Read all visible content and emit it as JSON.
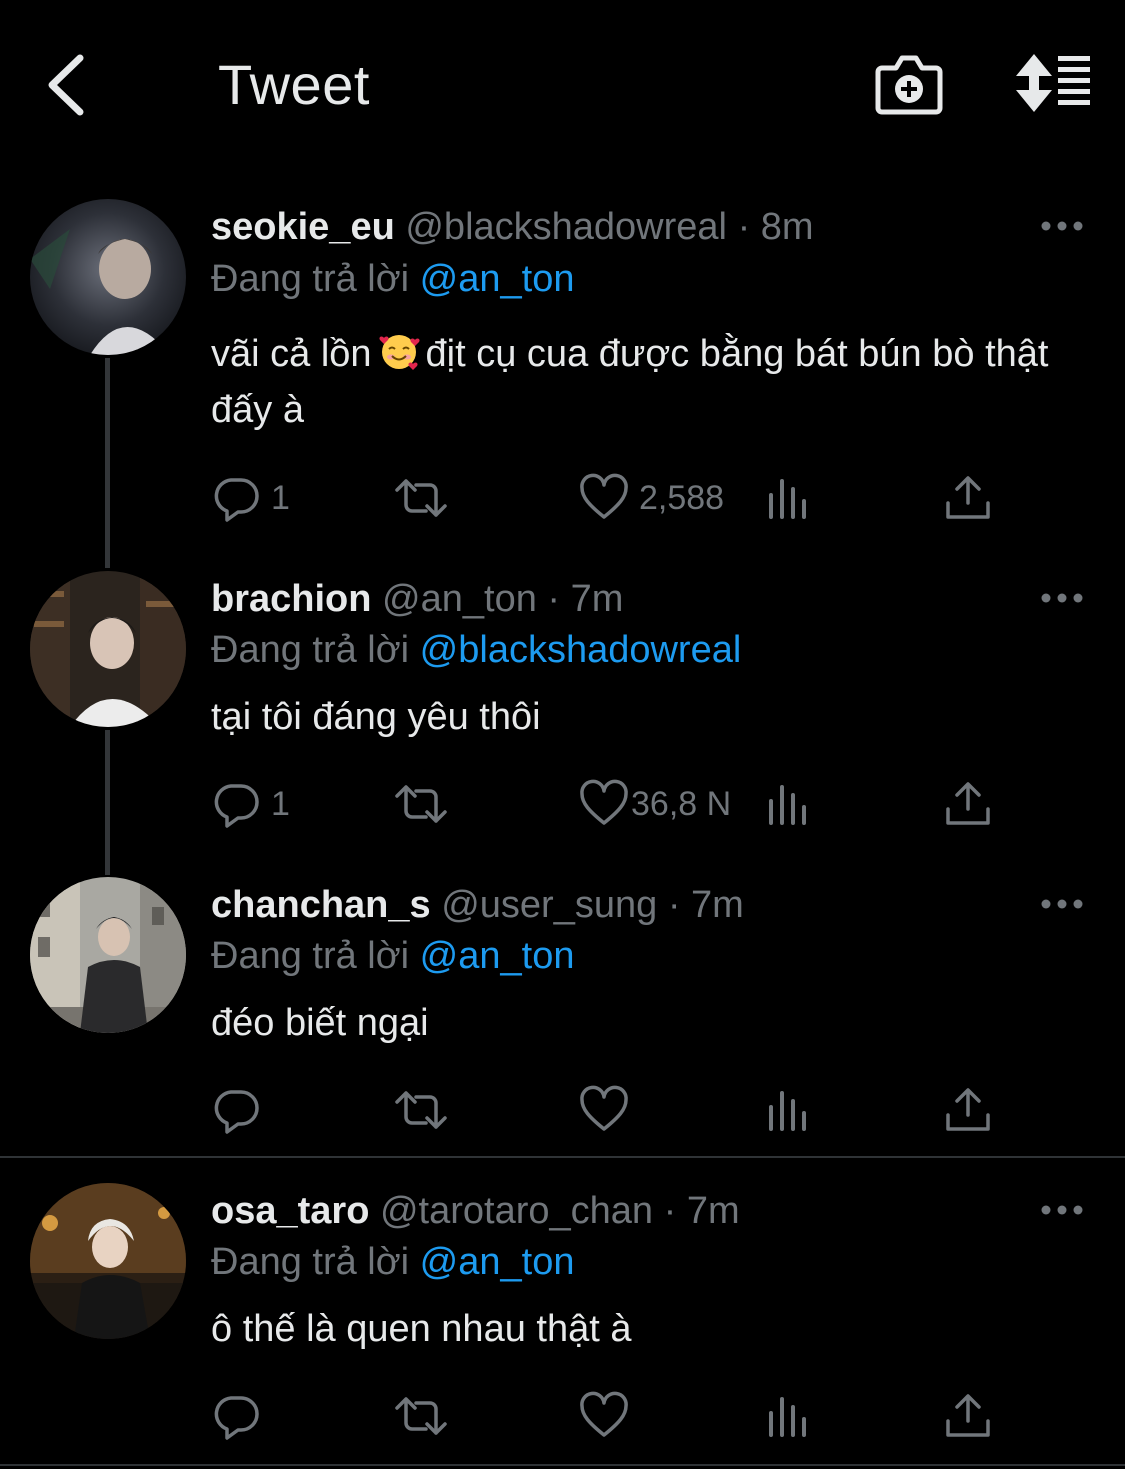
{
  "header": {
    "title": "Tweet"
  },
  "colors": {
    "background": "#000000",
    "text": "#e7e9ea",
    "secondary": "#71767b",
    "accent": "#1d9bf0"
  },
  "icons": {
    "back": "chevron-left-icon",
    "camera": "camera-plus-icon",
    "sort": "sort-icon",
    "reply": "reply-icon",
    "retweet": "retweet-icon",
    "like": "heart-icon",
    "views": "views-icon",
    "share": "share-icon",
    "more": "more-icon"
  },
  "reply_prefix": "Đang trả lời",
  "tweets": [
    {
      "name": "seokie_eu",
      "handle": "@blackshadowreal",
      "time": "· 8m",
      "replying_to": "@an_ton",
      "text_before_emoji": "vãi cả lồn",
      "emoji": "🥰",
      "text_after_emoji": "địt cụ cua được bằng bát bún bò thật đấy à",
      "reply_count": "1",
      "like_count": "2,588"
    },
    {
      "name": "brachion",
      "handle": "@an_ton",
      "time": "· 7m",
      "replying_to": "@blackshadowreal",
      "text": "tại tôi đáng yêu thôi",
      "reply_count": "1",
      "like_count": "36,8 N"
    },
    {
      "name": "chanchan_s",
      "handle": "@user_sung",
      "time": "· 7m",
      "replying_to": "@an_ton",
      "text": "đéo biết ngại",
      "reply_count": "",
      "like_count": ""
    },
    {
      "name": "osa_taro",
      "handle": "@tarotaro_chan",
      "time": "· 7m",
      "replying_to": "@an_ton",
      "text": "ô thế là quen nhau thật à",
      "reply_count": "",
      "like_count": ""
    }
  ]
}
